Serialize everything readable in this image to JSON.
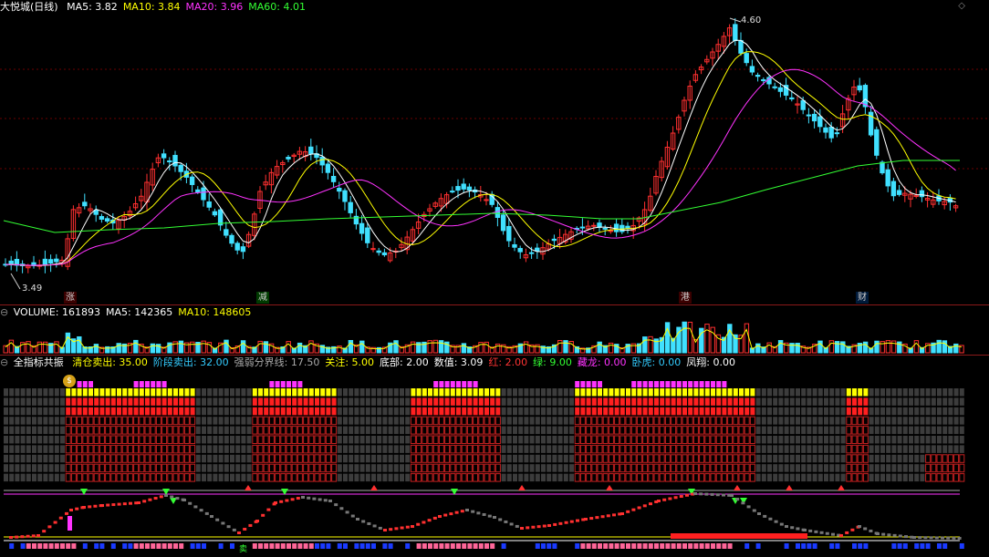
{
  "main": {
    "title": "大悦城(日线)",
    "ma": [
      {
        "label": "MA5: 3.82",
        "color": "#ffffff"
      },
      {
        "label": "MA10: 3.84",
        "color": "#ffff00"
      },
      {
        "label": "MA20: 3.96",
        "color": "#ff33ff"
      },
      {
        "label": "MA60: 4.01",
        "color": "#33ff33"
      }
    ],
    "high_label": "4.60",
    "low_label": "3.49",
    "events": [
      {
        "text": "涨",
        "color": "#ff4040"
      },
      {
        "text": "减",
        "color": "#33ff33"
      },
      {
        "text": "港",
        "color": "#ff4040"
      },
      {
        "text": "财",
        "color": "#88ccff"
      }
    ]
  },
  "volume": {
    "items": [
      {
        "label": "VOLUME: 161893",
        "color": "#ffffff"
      },
      {
        "label": "MA5: 142365",
        "color": "#ffffff"
      },
      {
        "label": "MA10: 148605",
        "color": "#ffff00"
      }
    ]
  },
  "indicator": {
    "name": "全指标共振",
    "items": [
      {
        "label": "清仓卖出: 35.00",
        "color": "#ffff00"
      },
      {
        "label": "阶段卖出: 32.00",
        "color": "#33ccff"
      },
      {
        "label": "强弱分界线: 17.50",
        "color": "#aaaaaa"
      },
      {
        "label": "关注: 5.00",
        "color": "#ffff00"
      },
      {
        "label": "底部: 2.00",
        "color": "#ffffff"
      },
      {
        "label": "数值: 3.09",
        "color": "#ffffff"
      },
      {
        "label": "红: 2.00",
        "color": "#ff3333"
      },
      {
        "label": "绿: 9.00",
        "color": "#33ff33"
      },
      {
        "label": "藏龙: 0.00",
        "color": "#ff33ff"
      },
      {
        "label": "卧虎: 0.00",
        "color": "#33ccff"
      },
      {
        "label": "凤翔: 0.00",
        "color": "#ffffff"
      }
    ],
    "coin_icon_label": "$",
    "small_label": "卖"
  },
  "controls": {
    "collapse": "⊖",
    "diamond": "◇"
  }
}
